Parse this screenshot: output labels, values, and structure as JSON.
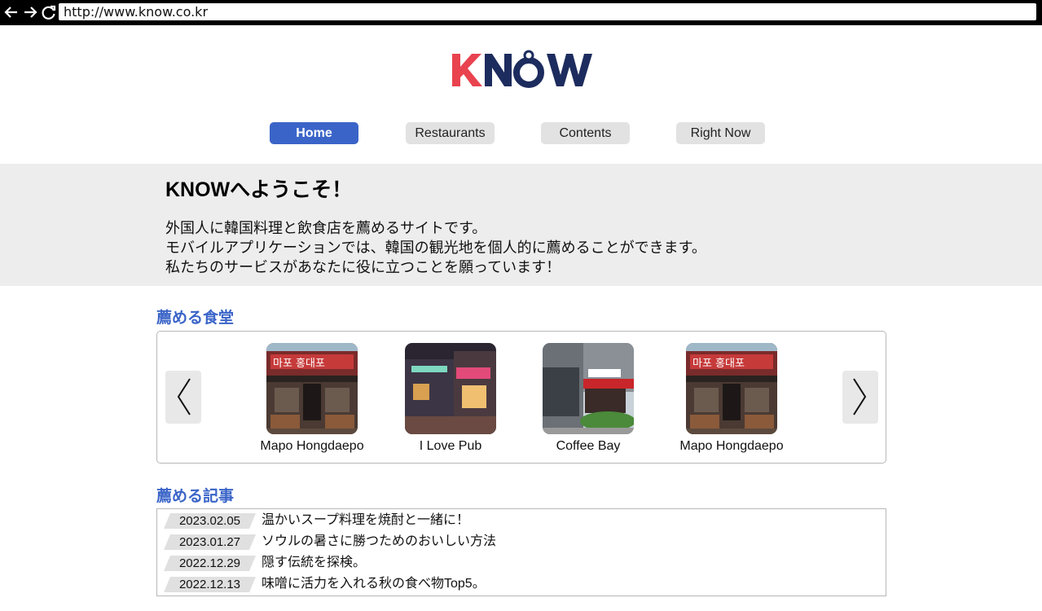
{
  "browser": {
    "url": "http://www.know.co.kr"
  },
  "logo": {
    "text": "KNOW",
    "colors": {
      "k": "#e8434f",
      "rest": "#1d2c5e"
    }
  },
  "nav": {
    "tabs": [
      {
        "label": "Home",
        "active": true
      },
      {
        "label": "Restaurants",
        "active": false
      },
      {
        "label": "Contents",
        "active": false
      },
      {
        "label": "Right Now",
        "active": false
      }
    ]
  },
  "welcome": {
    "title": "KNOWへようこそ！",
    "lines": [
      "外国人に韓国料理と飲食店を薦めるサイトです。",
      "モバイルアプリケーションでは、韓国の観光地を個人的に薦めることができます。",
      "私たちのサービスがあなたに役に立つことを願っています！"
    ]
  },
  "restaurants": {
    "title": "薦める食堂",
    "items": [
      {
        "name": "Mapo Hongdaepo",
        "image": "mapo-storefront-image"
      },
      {
        "name": "I Love Pub",
        "image": "pub-night-image"
      },
      {
        "name": "Coffee Bay",
        "image": "coffee-shop-image"
      },
      {
        "name": "Mapo Hongdaepo",
        "image": "mapo-storefront-image"
      }
    ]
  },
  "articles": {
    "title": "薦める記事",
    "items": [
      {
        "date": "2023.02.05",
        "title": "温かいスープ料理を焼酎と一緒に！"
      },
      {
        "date": "2023.01.27",
        "title": "ソウルの暑さに勝つためのおいしい方法"
      },
      {
        "date": "2022.12.29",
        "title": "隠す伝統を探検。"
      },
      {
        "date": "2022.12.13",
        "title": "味噌に活力を入れる秋の食べ物Top5。"
      }
    ]
  },
  "theme": {
    "accent": "#3a64c8",
    "band": "#ededed",
    "tab_inactive": "#e2e2e2"
  }
}
